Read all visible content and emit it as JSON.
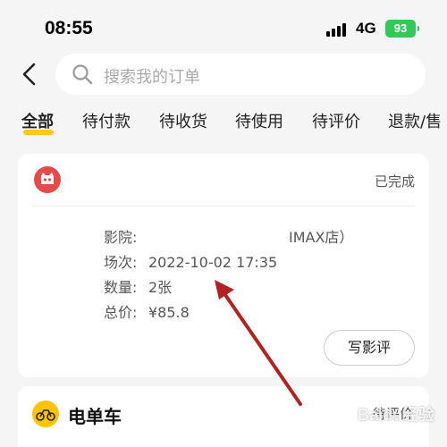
{
  "status_bar": {
    "time": "08:55",
    "network": "4G",
    "battery": "93"
  },
  "search": {
    "placeholder": "搜索我的订单"
  },
  "tabs": [
    "全部",
    "待付款",
    "待收货",
    "待使用",
    "待评价",
    "退款/售"
  ],
  "order1": {
    "status": "已完成",
    "cinema_label": "影院:",
    "cinema_value": "IMAX店）",
    "session_label": "场次:",
    "session_value": "2022-10-02 17:35",
    "qty_label": "数量:",
    "qty_value": "2张",
    "total_label": "总价:",
    "total_value": "¥85.8",
    "review_button": "写影评"
  },
  "order2": {
    "title": "电单车",
    "status": "待评价"
  },
  "watermark": "Baidu经验",
  "colors": {
    "accent": "#ffc300",
    "arrow": "#b22222",
    "logo_red": "#e54b4b"
  }
}
